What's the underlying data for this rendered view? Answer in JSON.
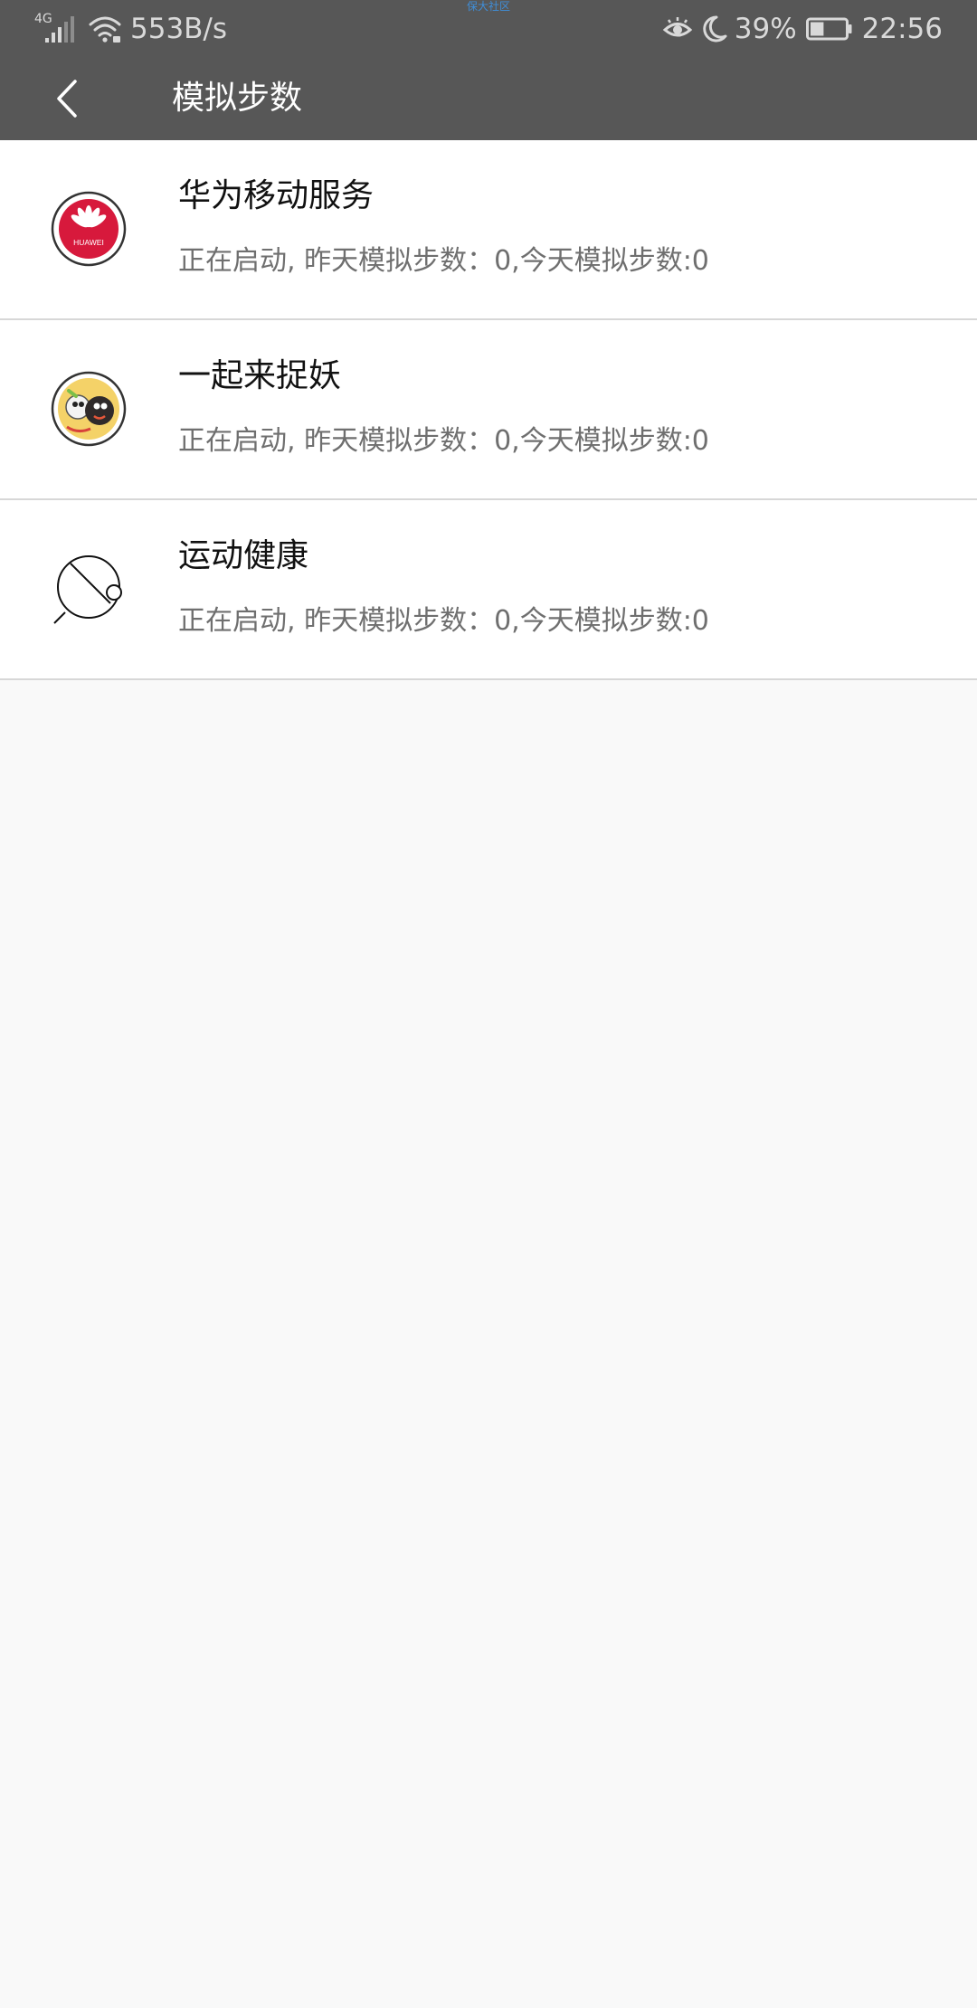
{
  "status_bar": {
    "network_type": "4G",
    "speed": "553B/s",
    "top_note": "保大社区",
    "battery": "39%",
    "battery_level": 0.39,
    "time": "22:56"
  },
  "app_bar": {
    "title": "模拟步数",
    "back_icon": "back-arrow"
  },
  "apps": [
    {
      "name": "华为移动服务",
      "status": "正在启动, 昨天模拟步数：0,今天模拟步数:0",
      "icon": "huawei-mobile-services",
      "logo_text": "HUAWEI"
    },
    {
      "name": "一起来捉妖",
      "status": "正在启动, 昨天模拟步数：0,今天模拟步数:0",
      "icon": "yiqilaizhuoyao-game"
    },
    {
      "name": "运动健康",
      "status": "正在启动, 昨天模拟步数：0,今天模拟步数:0",
      "icon": "sports-health"
    }
  ],
  "colors": {
    "top_bar": "#575757",
    "page_background": "#f9f9f9",
    "divider": "#d7d7d7",
    "huawei_red": "#d7193c"
  }
}
